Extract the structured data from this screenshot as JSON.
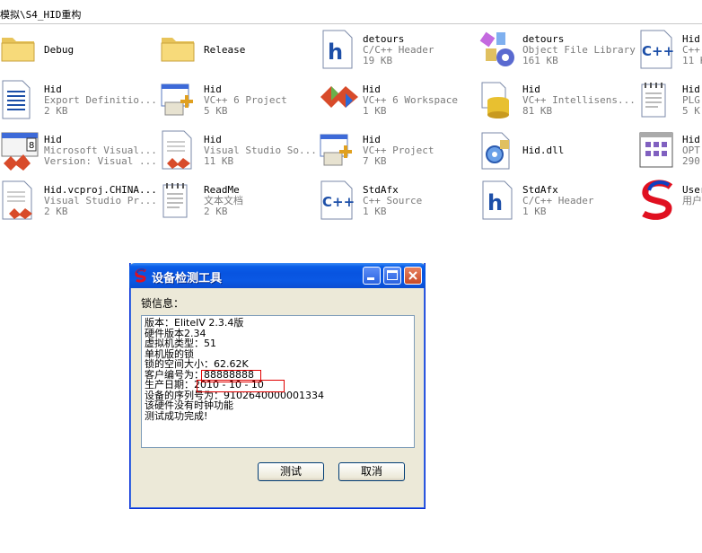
{
  "address": {
    "path": "模拟\\S4_HID重构"
  },
  "files": [
    {
      "name": "Debug",
      "type": "",
      "size": "",
      "icon": "folder-icon"
    },
    {
      "name": "Release",
      "type": "",
      "size": "",
      "icon": "folder-icon"
    },
    {
      "name": "detours",
      "type": "C/C++ Header",
      "size": "19 KB",
      "icon": "c-header-icon"
    },
    {
      "name": "detours",
      "type": "Object File Library",
      "size": "161 KB",
      "icon": "library-icon"
    },
    {
      "name": "Hid",
      "type": "C++",
      "size": "11 K",
      "icon": "cpp-source-icon"
    },
    {
      "name": "Hid",
      "type": "Export Definitio...",
      "size": "2 KB",
      "icon": "text-document-icon"
    },
    {
      "name": "Hid",
      "type": "VC++ 6 Project",
      "size": "5 KB",
      "icon": "vc-project-icon"
    },
    {
      "name": "Hid",
      "type": "VC++ 6 Workspace",
      "size": "1 KB",
      "icon": "vc-workspace-icon"
    },
    {
      "name": "Hid",
      "type": "VC++ Intellisens...",
      "size": "81 KB",
      "icon": "database-icon"
    },
    {
      "name": "Hid",
      "type": "PLG",
      "size": "5 K",
      "icon": "notepad-icon"
    },
    {
      "name": "Hid",
      "type": "Microsoft Visual...",
      "size": "Version: Visual ...",
      "icon": "vs-solution-icon"
    },
    {
      "name": "Hid",
      "type": "Visual Studio So...",
      "size": "11 KB",
      "icon": "vs-suo-icon"
    },
    {
      "name": "Hid",
      "type": "VC++ Project",
      "size": "7 KB",
      "icon": "vc-project-icon"
    },
    {
      "name": "Hid.dll",
      "type": "",
      "size": "",
      "icon": "dll-gear-icon"
    },
    {
      "name": "Hid.",
      "type": "OPT",
      "size": "290",
      "icon": "opt-file-icon"
    },
    {
      "name": "Hid.vcproj.CHINA...",
      "type": "Visual Studio Pr...",
      "size": "2 KB",
      "icon": "vs-user-icon"
    },
    {
      "name": "ReadMe",
      "type": "文本文档",
      "size": "2 KB",
      "icon": "notepad-icon"
    },
    {
      "name": "StdAfx",
      "type": "C++ Source",
      "size": "1 KB",
      "icon": "cpp-source-icon"
    },
    {
      "name": "StdAfx",
      "type": "C/C++ Header",
      "size": "1 KB",
      "icon": "c-header-icon"
    },
    {
      "name": "User",
      "type": "用户",
      "size": "",
      "icon": "app-s-logo-icon"
    }
  ],
  "dialog": {
    "title": "设备检测工具",
    "lock_info_label": "锁信息：",
    "lines": [
      "版本：EliteIV 2.3.4版",
      "硬件版本2.34",
      "虚拟机类型：51",
      "单机版的锁",
      "锁的空间大小：62.62K",
      "客户编号为：88888888",
      "生产日期：2010 - 10 - 10",
      "设备的序列号为：9102640000001334",
      "该硬件没有时钟功能",
      "测试成功完成!"
    ],
    "test_button": "测试",
    "cancel_button": "取消"
  },
  "colors": {
    "titlebar": "#0a58e4",
    "highlight": "#e00000",
    "close": "#c84a27"
  }
}
